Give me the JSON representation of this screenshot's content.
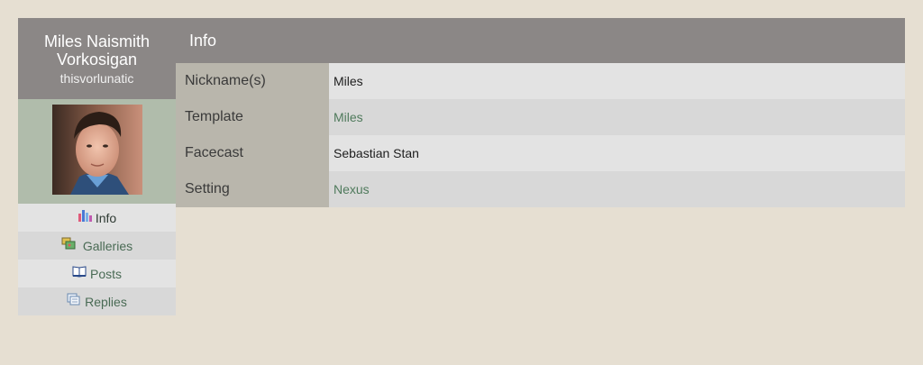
{
  "profile": {
    "name": "Miles Naismith Vorkosigan",
    "screenname": "thisvorlunatic"
  },
  "nav": [
    {
      "label": "Info",
      "icon": "bar-chart-icon"
    },
    {
      "label": "Galleries",
      "icon": "galleries-icon"
    },
    {
      "label": "Posts",
      "icon": "book-icon"
    },
    {
      "label": "Replies",
      "icon": "replies-icon"
    }
  ],
  "main": {
    "title": "Info",
    "rows": [
      {
        "key": "Nickname(s)",
        "value": "Miles"
      },
      {
        "key": "Template",
        "value": "Miles"
      },
      {
        "key": "Facecast",
        "value": "Sebastian Stan"
      },
      {
        "key": "Setting",
        "value": "Nexus"
      }
    ]
  },
  "colors": {
    "background": "#e6dfd2",
    "header": "#8b8786",
    "link": "#4f7a5c",
    "key_column": "#b9b6ac"
  }
}
